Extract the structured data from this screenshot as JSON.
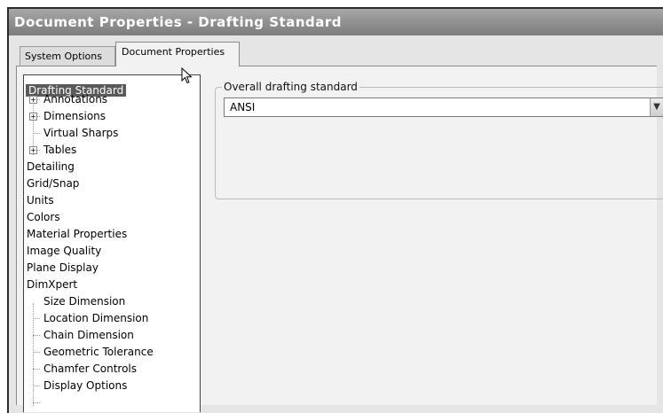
{
  "window": {
    "title": "Document Properties - Drafting Standard"
  },
  "tabs": [
    {
      "label": "System Options"
    },
    {
      "label": "Document Properties"
    }
  ],
  "tree": {
    "items": [
      {
        "label": "Drafting Standard",
        "selected": true
      },
      {
        "label": "Annotations",
        "expandable": true
      },
      {
        "label": "Dimensions",
        "expandable": true
      },
      {
        "label": "Virtual Sharps"
      },
      {
        "label": "Tables",
        "expandable": true
      },
      {
        "label": "Detailing"
      },
      {
        "label": "Grid/Snap"
      },
      {
        "label": "Units"
      },
      {
        "label": "Colors"
      },
      {
        "label": "Material Properties"
      },
      {
        "label": "Image Quality"
      },
      {
        "label": "Plane Display"
      },
      {
        "label": "DimXpert"
      },
      {
        "label": "Size Dimension"
      },
      {
        "label": "Location Dimension"
      },
      {
        "label": "Chain Dimension"
      },
      {
        "label": "Geometric Tolerance"
      },
      {
        "label": "Chamfer Controls"
      },
      {
        "label": "Display Options"
      }
    ]
  },
  "drafting": {
    "group_label": "Overall drafting standard",
    "selected_value": "ANSI"
  },
  "icons": {
    "expander": "plus-box-icon",
    "dropdown": "chevron-down-icon",
    "cursor": "mouse-pointer-icon"
  }
}
